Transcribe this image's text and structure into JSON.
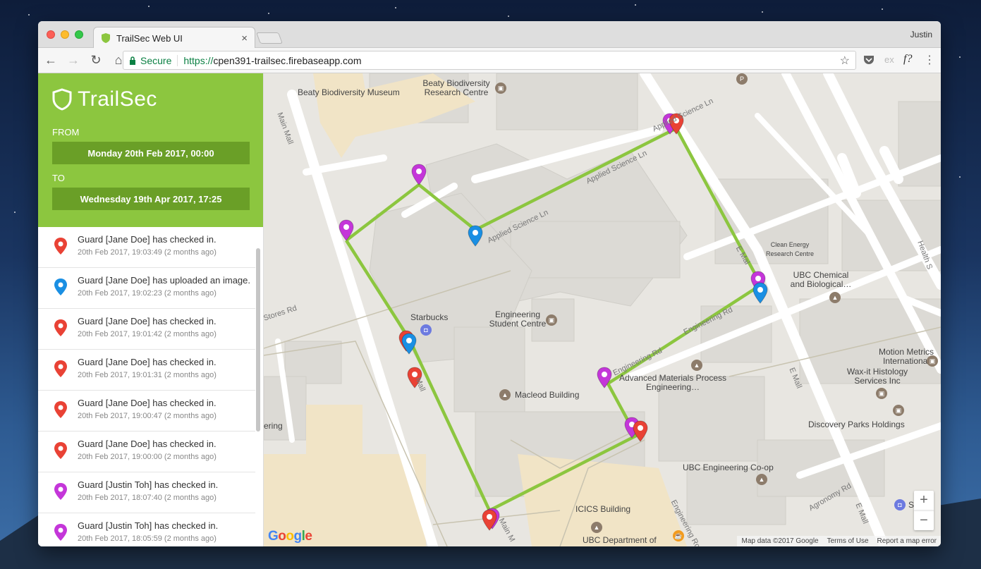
{
  "browser": {
    "tab_title": "TrailSec Web UI",
    "tab_close": "×",
    "profile_name": "Justin",
    "secure_label": "Secure",
    "url_scheme": "https://",
    "url_host": "cpen391-trailsec.firebaseapp.com",
    "ext_ex": "ex",
    "ext_f": "f?"
  },
  "sidebar": {
    "brand": "TrailSec",
    "from_label": "FROM",
    "from_value": "Monday 20th Feb 2017, 00:00",
    "to_label": "TO",
    "to_value": "Wednesday 19th Apr 2017, 17:25"
  },
  "feed": [
    {
      "text": "Guard [Jane Doe] has checked in.",
      "time": "20th Feb 2017, 19:03:49 (2 months ago)",
      "color": "#e94235"
    },
    {
      "text": "Guard [Jane Doe] has uploaded an image.",
      "time": "20th Feb 2017, 19:02:23 (2 months ago)",
      "color": "#1a8fe3"
    },
    {
      "text": "Guard [Jane Doe] has checked in.",
      "time": "20th Feb 2017, 19:01:42 (2 months ago)",
      "color": "#e94235"
    },
    {
      "text": "Guard [Jane Doe] has checked in.",
      "time": "20th Feb 2017, 19:01:31 (2 months ago)",
      "color": "#e94235"
    },
    {
      "text": "Guard [Jane Doe] has checked in.",
      "time": "20th Feb 2017, 19:00:47 (2 months ago)",
      "color": "#e94235"
    },
    {
      "text": "Guard [Jane Doe] has checked in.",
      "time": "20th Feb 2017, 19:00:00 (2 months ago)",
      "color": "#e94235"
    },
    {
      "text": "Guard [Justin Toh] has checked in.",
      "time": "20th Feb 2017, 18:07:40 (2 months ago)",
      "color": "#c436d9"
    },
    {
      "text": "Guard [Justin Toh] has checked in.",
      "time": "20th Feb 2017, 18:05:59 (2 months ago)",
      "color": "#c436d9"
    }
  ],
  "map": {
    "labels": {
      "beaty_museum": "Beaty Biodiversity Museum",
      "beaty_research": "Beaty Biodiversity Research Centre",
      "main_mall": "Main Mall",
      "applied_science": "Applied Science Ln",
      "clean_energy": "Clean Energy Research Centre",
      "ubc_chem": "UBC Chemical and Biological…",
      "starbucks": "Starbucks",
      "eng_student": "Engineering Student Centre",
      "stores_rd": "Stores Rd",
      "engineering_rd": "Engineering Rd",
      "motion_metrics": "Motion Metrics International",
      "wax_it": "Wax-it Histology Services Inc",
      "advanced_materials": "Advanced Materials Process Engineering…",
      "macleod": "Macleod Building",
      "e_mall": "E Mall",
      "discovery": "Discovery Parks Holdings",
      "ering": "ering",
      "ubc_coop": "UBC Engineering Co-op",
      "agronomy": "Agronomy Rd",
      "icics": "ICICS Building",
      "ubc_dept": "UBC Department of",
      "health": "Health S",
      "s_partial": "S",
      "main_mall_low": "Main M",
      "mall_mid": "Mall",
      "e_mal_upper": "E Mal",
      "engineering_ro": "Engineering Ro",
      "engineering_rd_low": "Engineering Rd",
      "parking": "P"
    },
    "zoom_in": "+",
    "zoom_out": "−",
    "google": "Google",
    "footer": {
      "map_data": "Map data ©2017 Google",
      "terms": "Terms of Use",
      "report": "Report a map error"
    }
  },
  "colors": {
    "brand_green": "#8cc63f",
    "date_box": "#6a9f27",
    "route": "#8cc63f",
    "pin_red": "#e94235",
    "pin_blue": "#1a8fe3",
    "pin_purple": "#c436d9"
  }
}
